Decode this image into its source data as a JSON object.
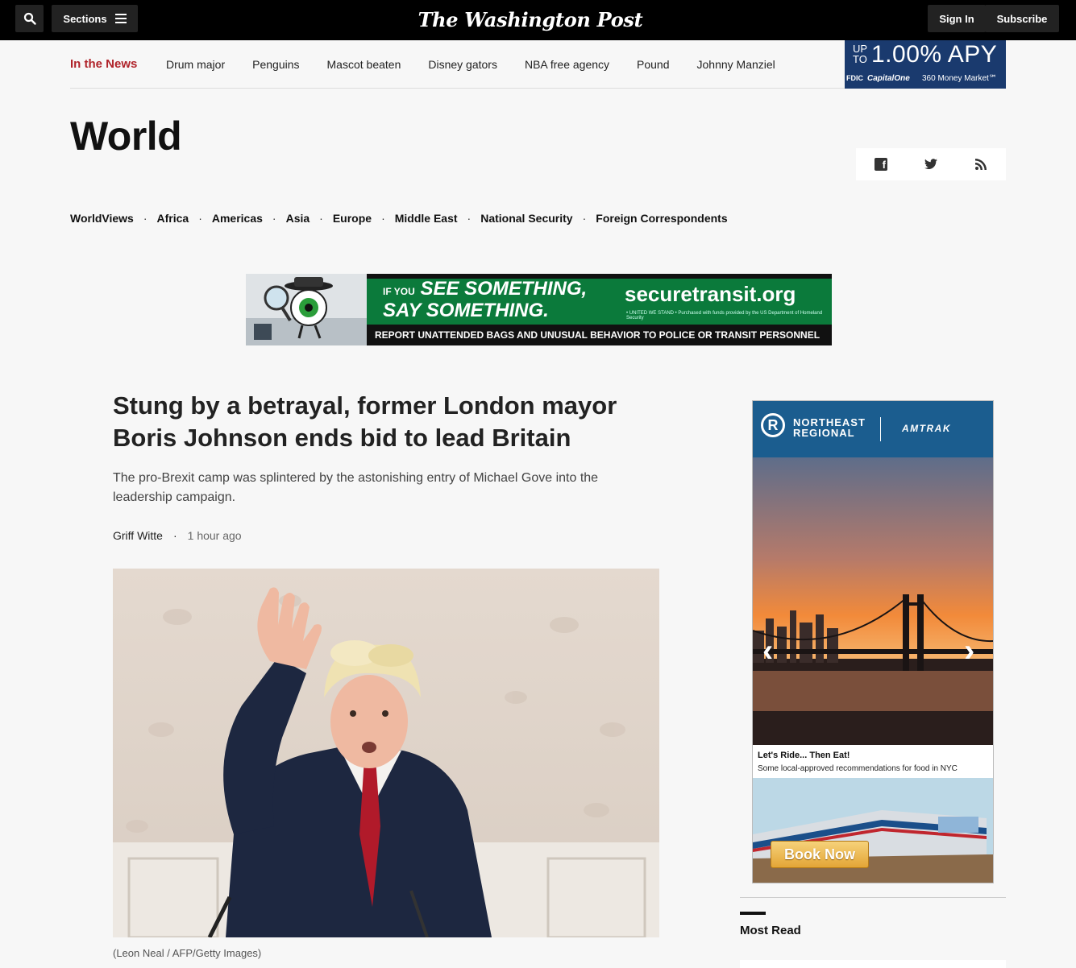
{
  "topbar": {
    "sections_label": "Sections",
    "masthead": "The Washington Post",
    "signin_label": "Sign In",
    "subscribe_label": "Subscribe"
  },
  "in_the_news": {
    "label": "In the News",
    "links": [
      "Drum major",
      "Penguins",
      "Mascot beaten",
      "Disney gators",
      "NBA free agency",
      "Pound",
      "Johnny Manziel"
    ]
  },
  "apy_ad": {
    "up_to": "UP TO",
    "rate": "1.00% APY",
    "fdic": "FDIC",
    "brand": "CapitalOne",
    "product": "360 Money Market℠"
  },
  "section": {
    "title": "World",
    "subnav": [
      "WorldViews",
      "Africa",
      "Americas",
      "Asia",
      "Europe",
      "Middle East",
      "National Security",
      "Foreign Correspondents"
    ]
  },
  "transit_ad": {
    "if_you": "IF YOU",
    "see_something": "SEE SOMETHING,",
    "say_something": "SAY SOMETHING.",
    "url": "securetransit.org",
    "fine_print": "• UNITED WE STAND • Purchased with funds provided by the US Department of Homeland Security",
    "report": "REPORT UNATTENDED BAGS  AND UNUSUAL BEHAVIOR TO POLICE OR TRANSIT PERSONNEL"
  },
  "article": {
    "headline": "Stung by a betrayal, former London mayor Boris Johnson ends bid to lead Britain",
    "dek": "The pro-Brexit camp was splintered by the astonishing entry of Michael Gove into the leadership campaign.",
    "author": "Griff Witte",
    "separator": "·",
    "time": "1 hour ago",
    "photo_caption": "(Leon Neal / AFP/Getty Images)"
  },
  "amtrak_ad": {
    "r_logo": "R",
    "northeast": "NORTHEAST",
    "regional": "REGIONAL",
    "amtrak": "AMTRAK",
    "prev": "‹",
    "next": "›",
    "caption_title": "Let's Ride... Then Eat!",
    "caption_text": "Some local-approved recommendations for food in NYC",
    "cta": "Book Now"
  },
  "rail": {
    "most_read": "Most Read"
  },
  "icons": {
    "search": "search-icon",
    "menu": "hamburger-icon",
    "facebook": "facebook-icon",
    "twitter": "twitter-icon",
    "rss": "rss-icon"
  },
  "colors": {
    "topbar": "#000000",
    "news_label": "#b0232a",
    "amtrak_blue": "#1b5d8f",
    "transit_green": "#0b7a3b"
  }
}
